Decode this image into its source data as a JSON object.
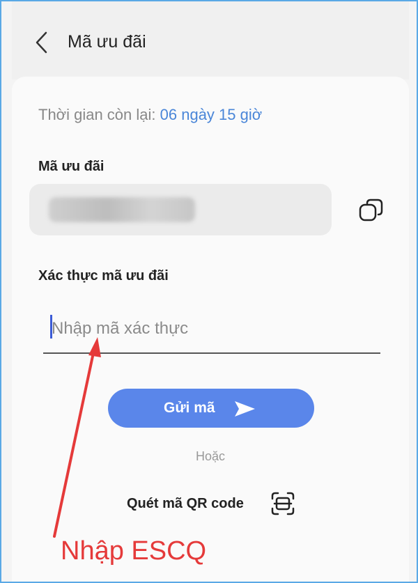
{
  "header": {
    "title": "Mã ưu đãi"
  },
  "timer": {
    "label": "Thời gian còn lại:",
    "value": "06 ngày 15 giờ"
  },
  "promo": {
    "label": "Mã ưu đãi"
  },
  "verify": {
    "label": "Xác thực mã ưu đãi",
    "placeholder": "Nhập mã xác thực",
    "send_label": "Gửi mã"
  },
  "divider_text": "Hoặc",
  "qr": {
    "label": "Quét mã QR code"
  },
  "annotation": {
    "text": "Nhập ESCQ",
    "color": "#e53a3a"
  },
  "colors": {
    "accent": "#5a86ea",
    "link": "#4a86d8"
  }
}
